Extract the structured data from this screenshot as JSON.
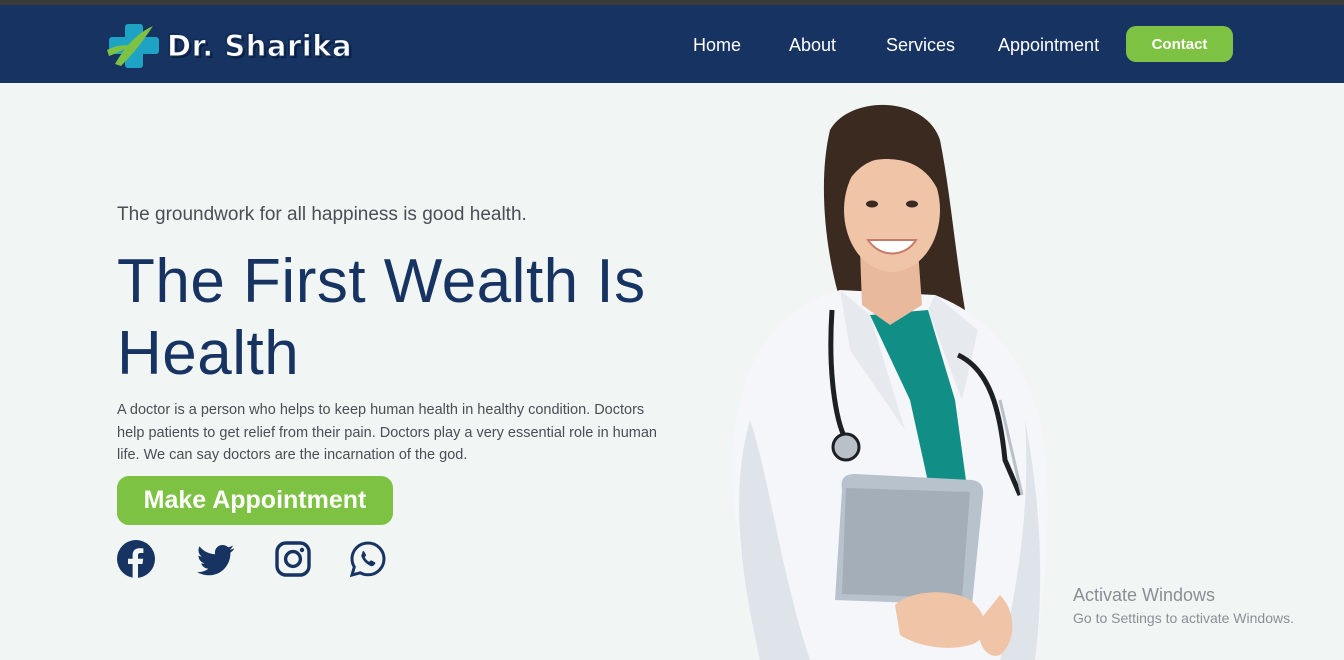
{
  "brand": {
    "name": "Dr. Sharika"
  },
  "nav": {
    "items": [
      "Home",
      "About",
      "Services",
      "Appointment"
    ],
    "contact_label": "Contact"
  },
  "hero": {
    "tagline": "The groundwork for all happiness is good health.",
    "title": "The First Wealth Is Health",
    "description": "A doctor is a person who helps to keep human health in healthy condition. Doctors help patients to get relief from their pain. Doctors play a very essential role in human life. We can say doctors are the incarnation of the god.",
    "cta_label": "Make Appointment"
  },
  "socials": [
    "facebook-icon",
    "twitter-icon",
    "instagram-icon",
    "whatsapp-icon"
  ],
  "watermark": {
    "title": "Activate Windows",
    "subtitle": "Go to Settings to activate Windows."
  },
  "colors": {
    "navy": "#163362",
    "accent_green": "#7dc242",
    "background": "#f1f5f4",
    "teal": "#118e86"
  }
}
